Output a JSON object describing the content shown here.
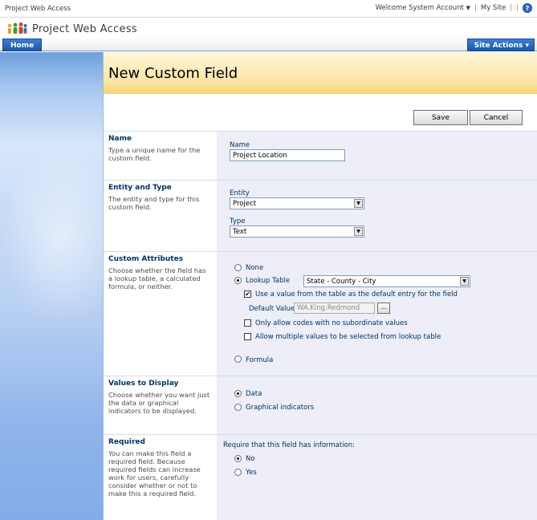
{
  "topbar": {
    "site_name": "Project Web Access",
    "welcome": "Welcome System Account",
    "welcome_caret": "▼",
    "my_site": "My Site",
    "separator": "|",
    "help": "?"
  },
  "header": {
    "title": "Project Web Access"
  },
  "nav": {
    "home_tab": "Home",
    "site_actions": "Site Actions ▾"
  },
  "page": {
    "title": "New Custom Field",
    "save_label": "Save",
    "cancel_label": "Cancel"
  },
  "sections": {
    "name": {
      "title": "Name",
      "desc": "Type a unique name for the custom field.",
      "field_label": "Name",
      "field_value": "Project Location"
    },
    "entity_type": {
      "title": "Entity and Type",
      "desc": "The entity and type for this custom field.",
      "entity_label": "Entity",
      "entity_value": "Project",
      "type_label": "Type",
      "type_value": "Text"
    },
    "custom_attributes": {
      "title": "Custom Attributes",
      "desc": "Choose whether the field has a lookup table, a calculated formula, or neither.",
      "none_label": "None",
      "lookup_label": "Lookup Table",
      "lookup_value": "State - County - City",
      "use_default_label": "Use a value from the table as the default entry for the field",
      "default_value_label": "Default Value",
      "default_value": "WA.King.Redmond",
      "ellipsis": "...",
      "no_subordinate_label": "Only allow codes with no subordinate values",
      "multiple_values_label": "Allow multiple values to be selected from lookup table",
      "formula_label": "Formula"
    },
    "values_display": {
      "title": "Values to Display",
      "desc": "Choose whether you want just the data or graphical indicators to be displayed.",
      "data_label": "Data",
      "graphical_label": "Graphical indicators"
    },
    "required": {
      "title": "Required",
      "desc": "You can make this field a required field. Because required fields can increase work for users, carefully consider whether or not to make this a required field.",
      "prompt": "Require that this field has information:",
      "no_label": "No",
      "yes_label": "Yes"
    }
  },
  "colors": {
    "brand_blue": "#1b56a8",
    "title_band": "#fde6a8",
    "label_navy": "#003366",
    "section_right_bg": "#edeef7"
  }
}
